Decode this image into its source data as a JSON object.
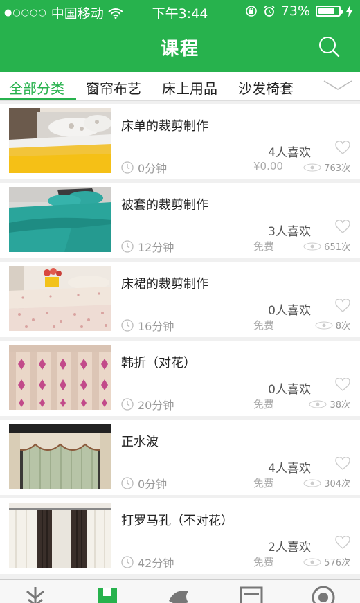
{
  "status_bar": {
    "carrier": "中国移动",
    "time": "下午3:44",
    "battery": "73%"
  },
  "header": {
    "title": "课程"
  },
  "tabs": [
    {
      "label": "全部分类",
      "active": true
    },
    {
      "label": "窗帘布艺",
      "active": false
    },
    {
      "label": "床上用品",
      "active": false
    },
    {
      "label": "沙发椅套",
      "active": false
    }
  ],
  "courses": [
    {
      "title": "床单的裁剪制作",
      "likes": "4人喜欢",
      "duration": "0分钟",
      "price": "¥0.00",
      "views": "763次"
    },
    {
      "title": "被套的裁剪制作",
      "likes": "3人喜欢",
      "duration": "12分钟",
      "price": "免费",
      "views": "651次"
    },
    {
      "title": "床裙的裁剪制作",
      "likes": "0人喜欢",
      "duration": "16分钟",
      "price": "免费",
      "views": "8次"
    },
    {
      "title": "韩折（对花）",
      "likes": "0人喜欢",
      "duration": "20分钟",
      "price": "免费",
      "views": "38次"
    },
    {
      "title": "正水波",
      "likes": "4人喜欢",
      "duration": "0分钟",
      "price": "免费",
      "views": "304次"
    },
    {
      "title": "打罗马孔（不对花）",
      "likes": "2人喜欢",
      "duration": "42分钟",
      "price": "免费",
      "views": "576次"
    }
  ],
  "bottom_nav": [
    "home-icon",
    "course-icon",
    "community-icon",
    "tv-icon",
    "profile-icon"
  ],
  "colors": {
    "accent": "#27b24d"
  }
}
